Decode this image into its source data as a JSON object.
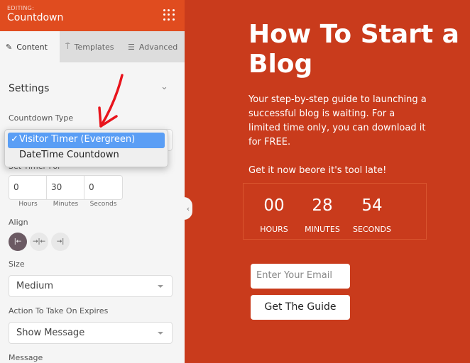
{
  "sidebar": {
    "editing_label": "EDITING:",
    "title": "Countdown",
    "tabs": [
      {
        "label": "Content"
      },
      {
        "label": "Templates"
      },
      {
        "label": "Advanced"
      }
    ],
    "section": "Settings",
    "countdown_type_label": "Countdown Type",
    "dropdown_options": [
      {
        "label": "Visitor Timer (Evergreen)",
        "selected": true
      },
      {
        "label": "DateTime Countdown",
        "selected": false
      }
    ],
    "set_timer_label": "Set Timer For",
    "timer": {
      "hours": "0",
      "minutes": "30",
      "seconds": "0",
      "hours_label": "Hours",
      "minutes_label": "Minutes",
      "seconds_label": "Seconds"
    },
    "align_label": "Align",
    "align_selected": "left",
    "size_label": "Size",
    "size_value": "Medium",
    "action_label": "Action To Take On Expires",
    "action_value": "Show Message",
    "message_label": "Message"
  },
  "preview": {
    "title": "How To Start a Blog",
    "description": "Your step-by-step guide to launching a successful blog is waiting. For a limited time only, you can download it for FREE.",
    "cta_text": "Get it now beore it's tool late!",
    "countdown": {
      "hours": "00",
      "minutes": "28",
      "seconds": "54",
      "hours_label": "HOURS",
      "minutes_label": "MINUTES",
      "seconds_label": "SECONDS"
    },
    "email_placeholder": "Enter Your Email",
    "button_label": "Get The Guide"
  },
  "colors": {
    "header": "#e04c1f",
    "preview_bg": "#c93b1c",
    "selected_option": "#5a9ef5",
    "annotation_arrow": "#e8141c"
  }
}
